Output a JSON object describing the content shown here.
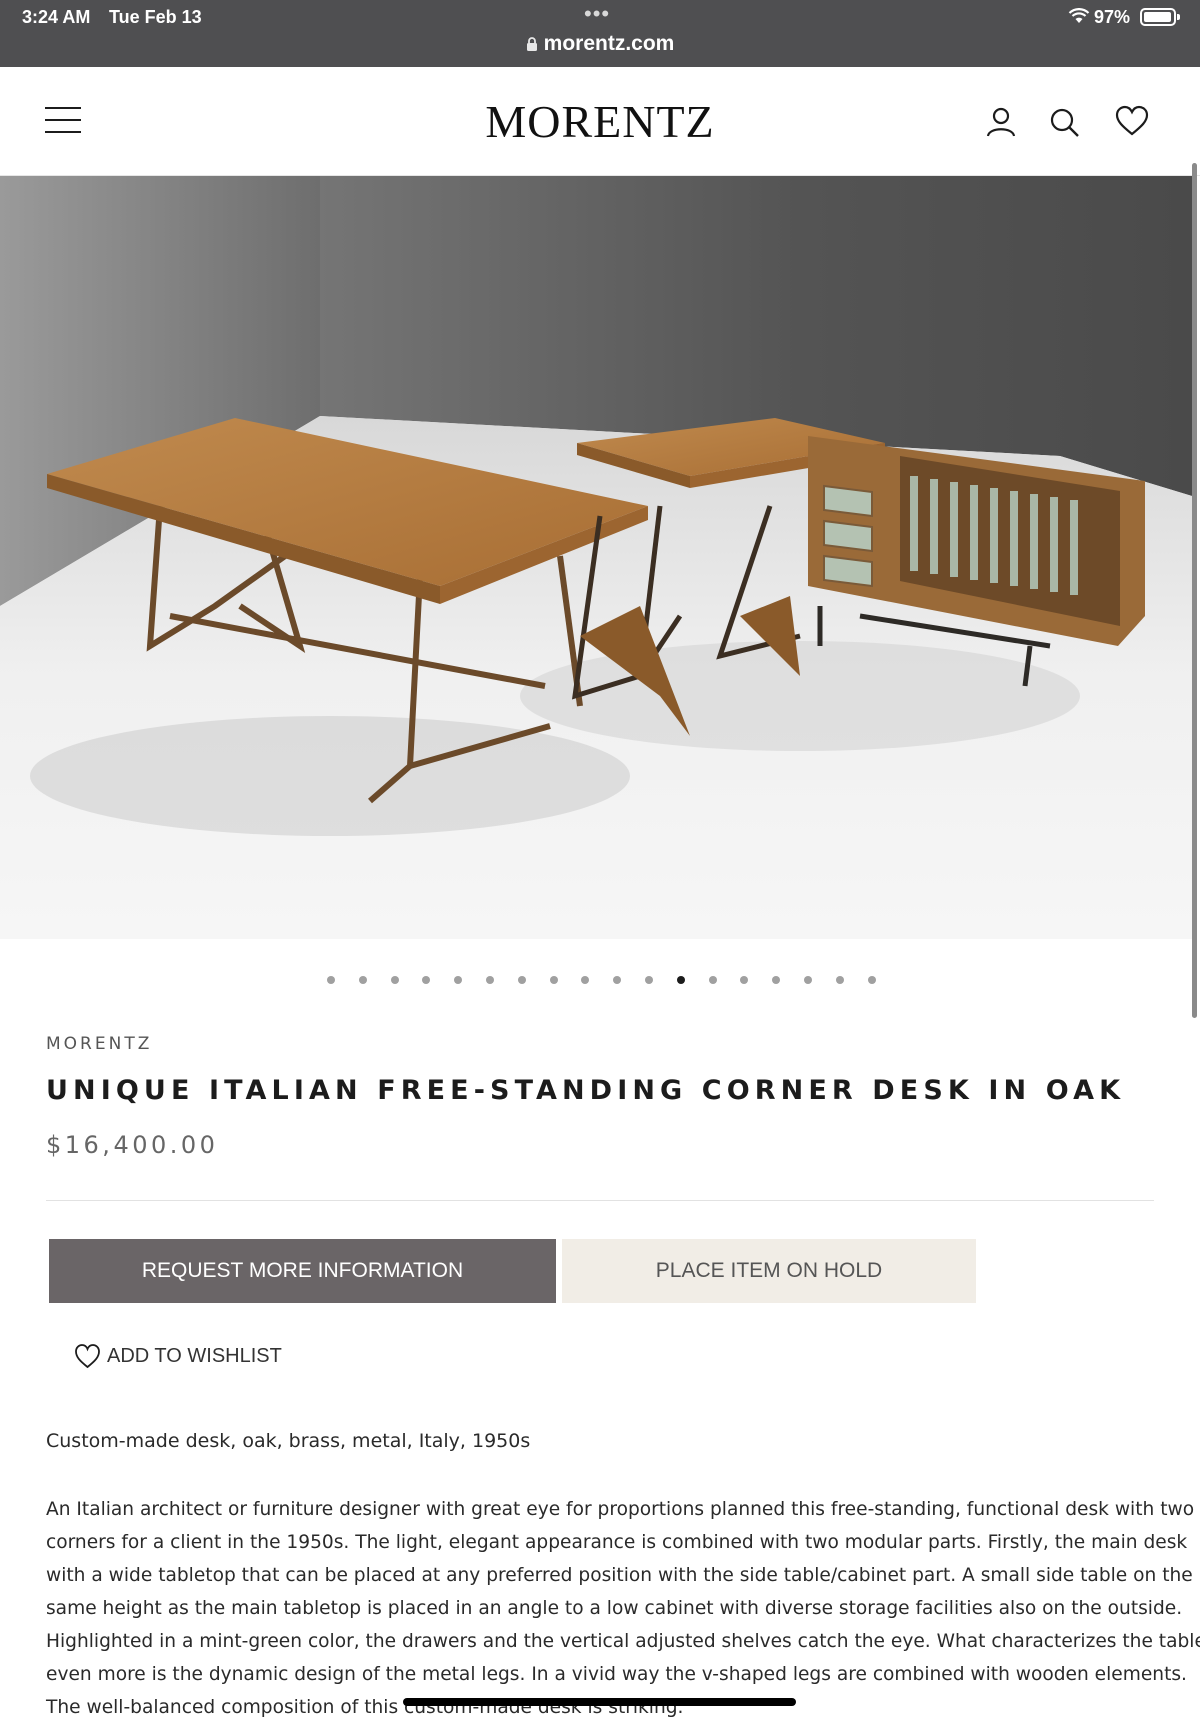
{
  "status": {
    "time": "3:24 AM",
    "date": "Tue Feb 13",
    "battery": "97%",
    "battery_level": 0.97
  },
  "browser": {
    "url": "morentz.com"
  },
  "header": {
    "logo": "MORENTZ"
  },
  "carousel": {
    "total": 18,
    "active_index": 11
  },
  "product": {
    "vendor": "MORENTZ",
    "title": "UNIQUE ITALIAN FREE-STANDING CORNER DESK IN OAK",
    "price": "$16,400.00",
    "request_button": "REQUEST MORE INFORMATION",
    "hold_button": "PLACE ITEM ON HOLD",
    "wishlist": "ADD TO WISHLIST",
    "subtitle": "Custom-made desk, oak, brass, metal, Italy, 1950s",
    "description_lines": [
      "An Italian architect or furniture designer with great eye for proportions planned this free-standing, functional desk with two",
      "corners for a client in the 1950s. The light, elegant appearance is combined with two modular parts. Firstly, the main desk",
      "with a wide tabletop that can be placed at any preferred position with the side table/cabinet part. A small side table on the",
      "same height as the main tabletop is placed in an angle to a low cabinet with diverse storage facilities also on the outside.",
      "Highlighted in a mint-green color, the drawers and the vertical adjusted shelves catch the eye. What characterizes the table",
      "even more is the dynamic design of the metal legs. In a vivid way the v-shaped legs are combined with wooden elements.",
      "The well-balanced composition of this custom-made desk is striking."
    ]
  },
  "colors": {
    "status_bar": "#4f4f51",
    "primary_button": "#6a6567",
    "secondary_button": "#f1ede6",
    "oak": "#b27a3e"
  }
}
